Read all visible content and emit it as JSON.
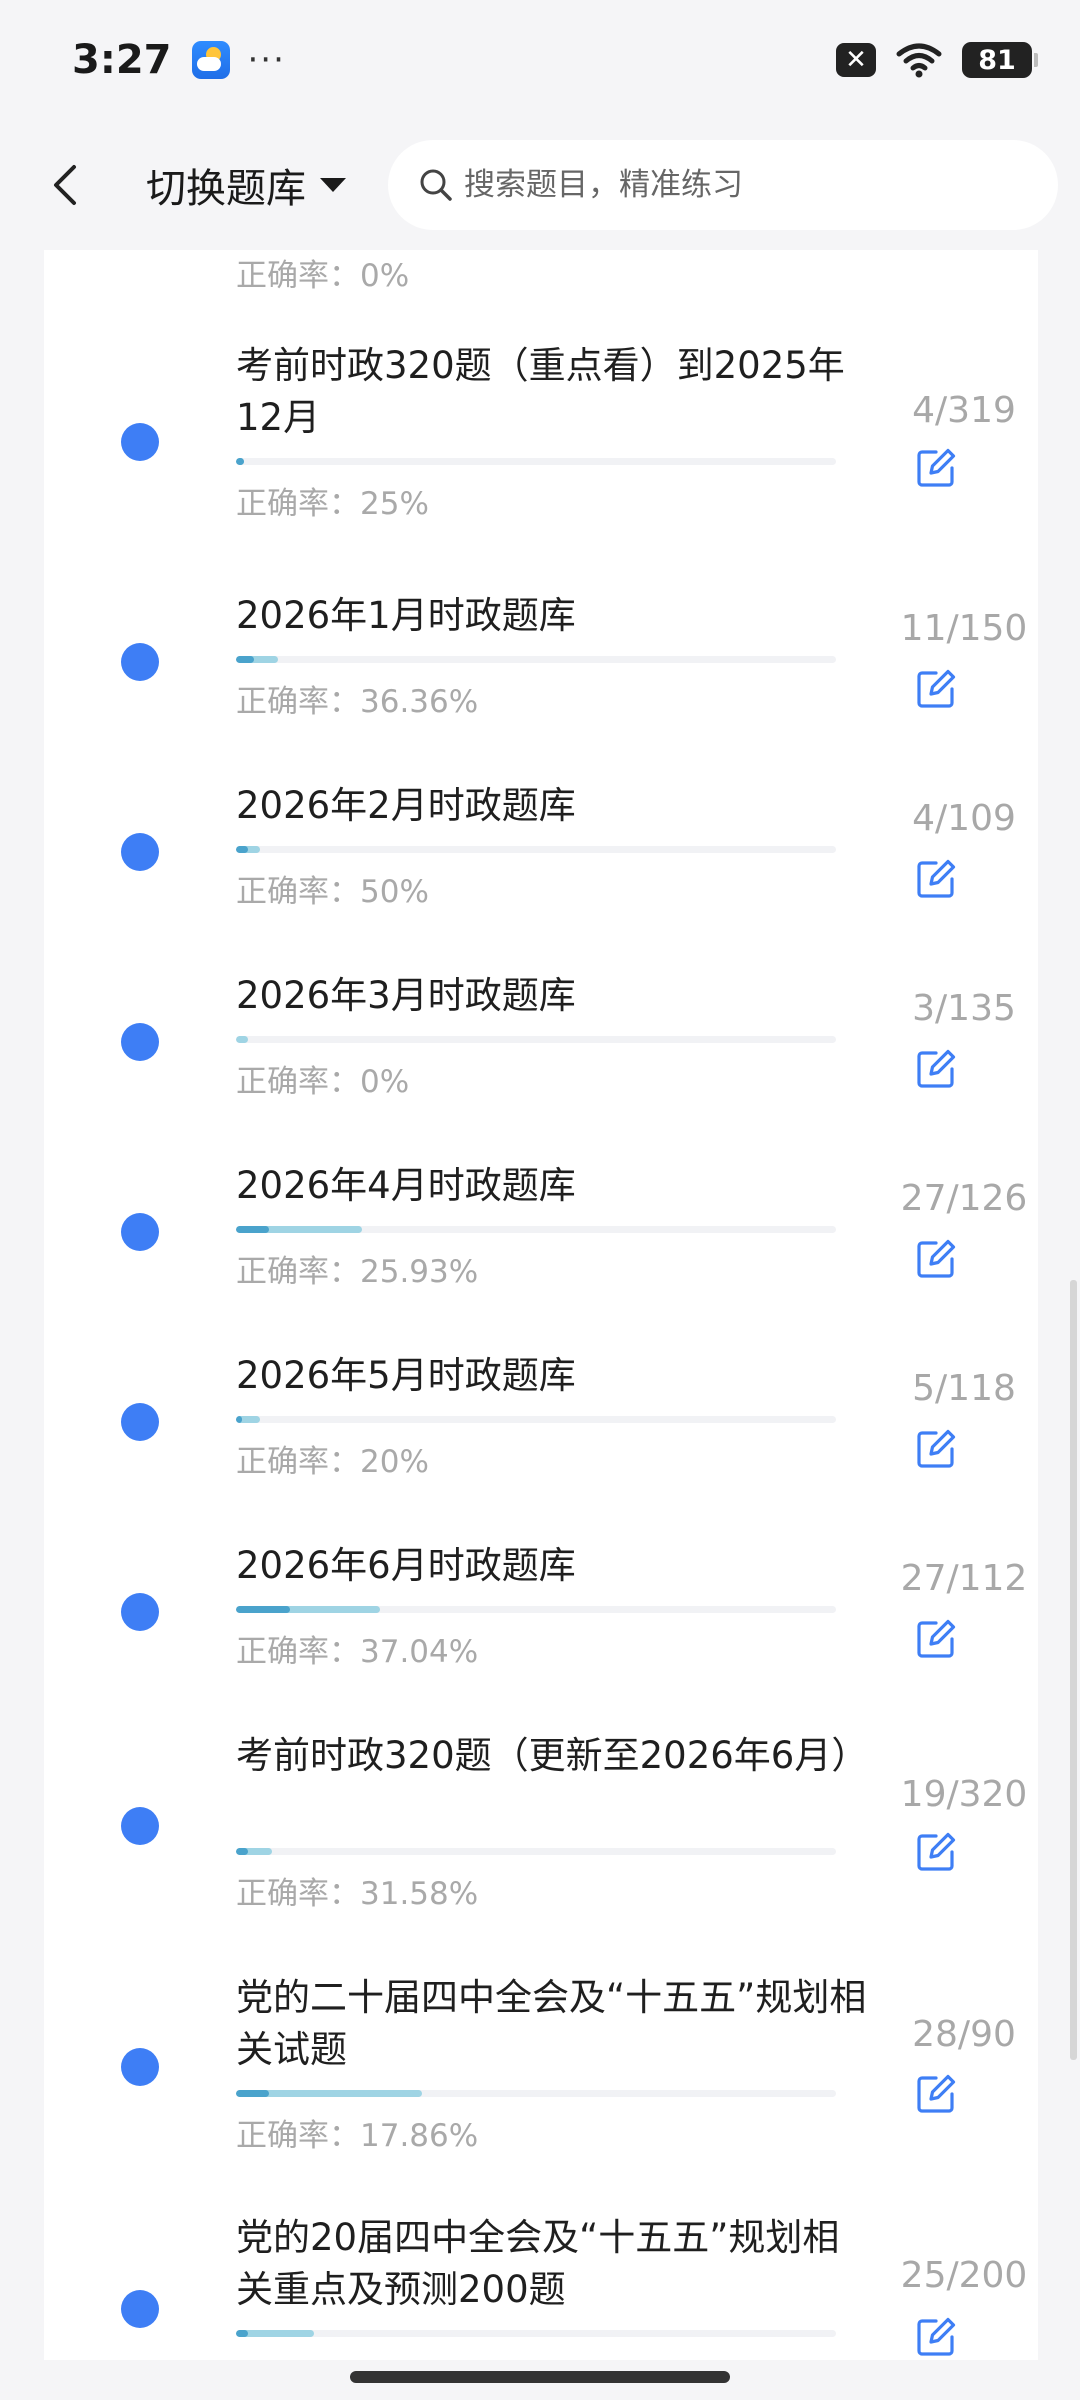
{
  "status_bar": {
    "time": "3:27",
    "battery": "81"
  },
  "header": {
    "switch_label": "切换题库",
    "search_placeholder": "搜索题目，精准练习"
  },
  "accuracy_prefix": "正确率：",
  "partial_item": {
    "accuracy": "0%"
  },
  "items": [
    {
      "title": "考前时政320题（重点看）到2025年12月",
      "count": "4/319",
      "accuracy": "25%",
      "progress": 0.0125,
      "progress_light": 0.013
    },
    {
      "title": "2026年1月时政题库",
      "count": "11/150",
      "accuracy": "36.36%",
      "progress": 0.03,
      "progress_light": 0.07
    },
    {
      "title": "2026年2月时政题库",
      "count": "4/109",
      "accuracy": "50%",
      "progress": 0.02,
      "progress_light": 0.04
    },
    {
      "title": "2026年3月时政题库",
      "count": "3/135",
      "accuracy": "0%",
      "progress": 0.0,
      "progress_light": 0.02
    },
    {
      "title": "2026年4月时政题库",
      "count": "27/126",
      "accuracy": "25.93%",
      "progress": 0.055,
      "progress_light": 0.21
    },
    {
      "title": "2026年5月时政题库",
      "count": "5/118",
      "accuracy": "20%",
      "progress": 0.01,
      "progress_light": 0.04
    },
    {
      "title": "2026年6月时政题库",
      "count": "27/112",
      "accuracy": "37.04%",
      "progress": 0.09,
      "progress_light": 0.24
    },
    {
      "title": "考前时政320题（更新至2026年6月）",
      "count": "19/320",
      "accuracy": "31.58%",
      "progress": 0.02,
      "progress_light": 0.06
    },
    {
      "title": "党的二十届四中全会及“十五五”规划相关试题",
      "count": "28/90",
      "accuracy": "17.86%",
      "progress": 0.055,
      "progress_light": 0.31
    },
    {
      "title": "党的20届四中全会及“十五五”规划相关重点及预测200题",
      "count": "25/200",
      "accuracy": "",
      "progress": 0.02,
      "progress_light": 0.13
    }
  ]
}
